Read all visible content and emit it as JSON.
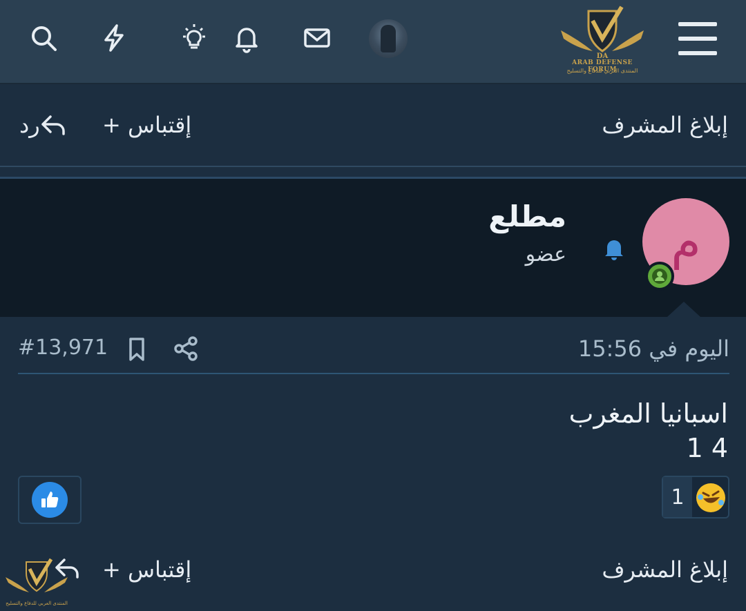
{
  "topbar": {
    "icons": [
      "search-icon",
      "lightning-icon",
      "lightbulb-icon",
      "bell-icon",
      "mail-icon"
    ],
    "logo_text_en": "ARAB DEFENSE FORUM",
    "logo_text_ar": "المنتدى العربي للدفاع والتسليح"
  },
  "actions_top": {
    "report": "إبلاغ المشرف",
    "quote": "+ إقتباس",
    "reply": "رد"
  },
  "user": {
    "avatar_letter": "م",
    "avatar_color": "#e08aa7",
    "name": "مطلع",
    "role": "عضو",
    "online_color": "#5fa93a"
  },
  "post": {
    "time": "اليوم في 15:56",
    "number": "#13,971",
    "line1": "اسبانيا المغرب",
    "line2": "1 4"
  },
  "reactions": {
    "count": "1",
    "emoji": "rofl-emoji",
    "like_color": "#2b8be6"
  },
  "actions_bottom": {
    "report": "إبلاغ المشرف",
    "quote": "+ إقتباس"
  },
  "bottom_logo_text": "المنتدى العربي للدفاع والتسليح"
}
